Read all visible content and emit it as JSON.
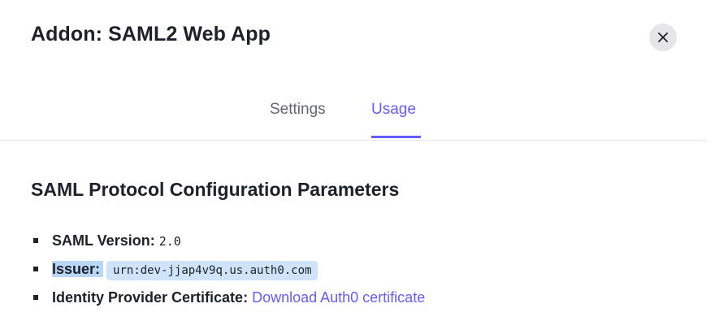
{
  "header": {
    "title": "Addon: SAML2 Web App",
    "close_icon": "close-icon"
  },
  "tabs": [
    {
      "label": "Settings",
      "active": false
    },
    {
      "label": "Usage",
      "active": true
    }
  ],
  "colors": {
    "accent": "#635dff",
    "text": "#1e212a",
    "muted": "#65676e",
    "selection": "#b9d7f7"
  },
  "section": {
    "title": "SAML Protocol Configuration Parameters",
    "params": [
      {
        "label": "SAML Version:",
        "value": "2.0"
      },
      {
        "label": "Issuer:",
        "value": "urn:dev-jjap4v9q.us.auth0.com"
      },
      {
        "label": "Identity Provider Certificate:",
        "link": "Download Auth0 certificate"
      }
    ]
  }
}
